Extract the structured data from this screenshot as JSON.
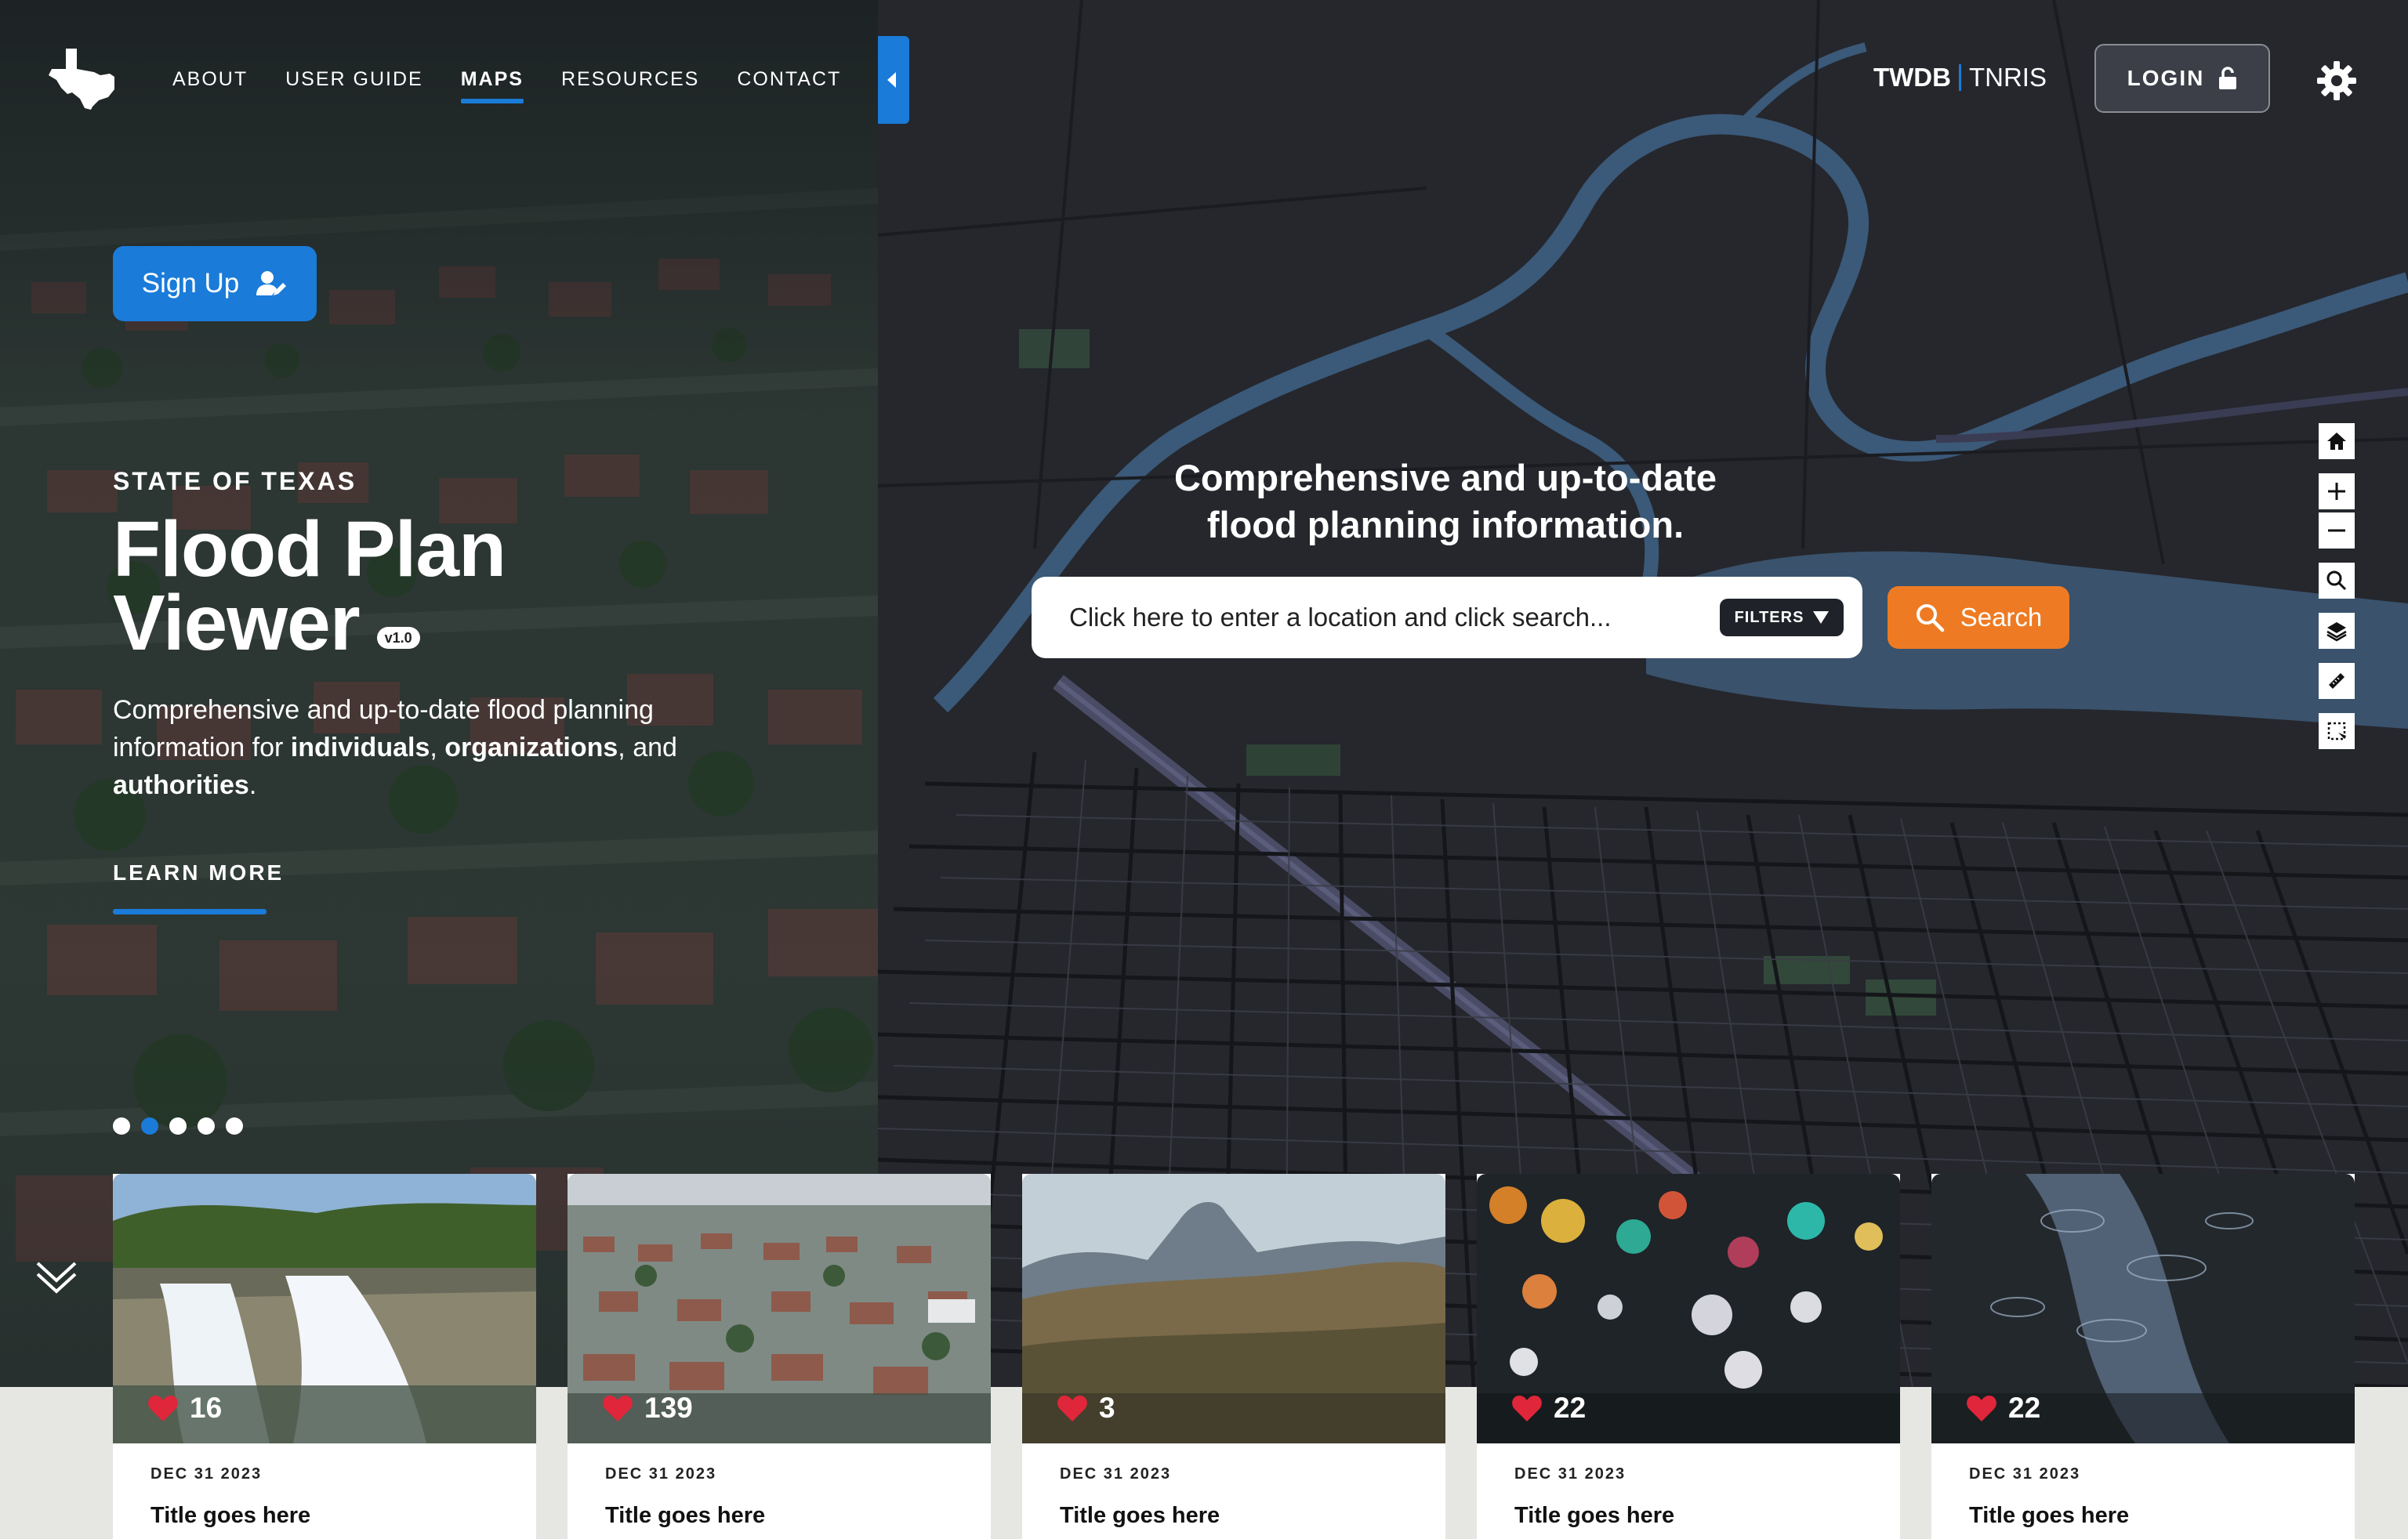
{
  "nav": {
    "items": [
      {
        "label": "ABOUT",
        "active": false
      },
      {
        "label": "USER GUIDE",
        "active": false
      },
      {
        "label": "MAPS",
        "active": true
      },
      {
        "label": "RESOURCES",
        "active": false
      },
      {
        "label": "CONTACT",
        "active": false
      }
    ]
  },
  "brand": {
    "primary": "TWDB",
    "secondary": "TNRIS",
    "accent": "#1a7bd9"
  },
  "header": {
    "login_label": "LOGIN",
    "login_icon": "unlock-icon",
    "settings_icon": "gear-icon"
  },
  "hero": {
    "signup_label": "Sign Up",
    "signup_icon": "user-edit-icon",
    "eyebrow": "STATE OF TEXAS",
    "title_line1": "Flood Plan",
    "title_line2": "Viewer",
    "version": "v1.0",
    "desc_pre": "Comprehensive and up-to-date flood planning information for ",
    "desc_b1": "individuals",
    "desc_mid1": ", ",
    "desc_b2": "organizations",
    "desc_mid2": ", and ",
    "desc_b3": "authorities",
    "desc_end": ".",
    "learn_more": "LEARN MORE",
    "carousel_count": 5,
    "carousel_active_index": 1
  },
  "search": {
    "tagline_line1": "Comprehensive and up-to-date",
    "tagline_line2": "flood planning information.",
    "placeholder": "Click here to enter a location and click search...",
    "filters_label": "FILTERS",
    "button_label": "Search",
    "button_color": "#ee7b23"
  },
  "map_tools": [
    "home-icon",
    "zoom-in-icon",
    "zoom-out-icon",
    "search-icon",
    "layers-icon",
    "ruler-icon",
    "select-area-icon"
  ],
  "cards": [
    {
      "likes": "16",
      "date": "DEC 31 2023",
      "title": "Title goes here",
      "image": "waterfall"
    },
    {
      "likes": "139",
      "date": "DEC 31 2023",
      "title": "Title goes here",
      "image": "flooded-town"
    },
    {
      "likes": "3",
      "date": "DEC 31 2023",
      "title": "Title goes here",
      "image": "mountain"
    },
    {
      "likes": "22",
      "date": "DEC 31 2023",
      "title": "Title goes here",
      "image": "rain-bokeh"
    },
    {
      "likes": "22",
      "date": "DEC 31 2023",
      "title": "Title goes here",
      "image": "rain-puddle"
    }
  ]
}
